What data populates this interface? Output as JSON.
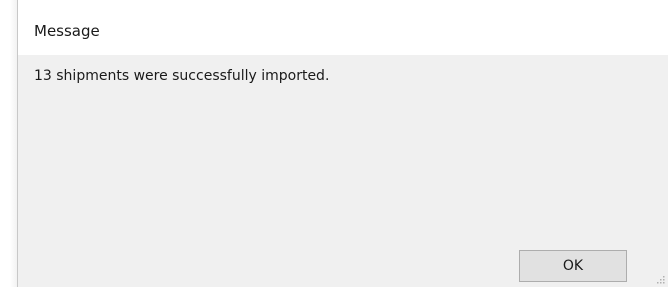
{
  "dialog": {
    "title": "Message",
    "message": "13 shipments were successfully imported.",
    "ok_label": "OK"
  },
  "colors": {
    "title_bar": "#ffffff",
    "body": "#f0f0f0",
    "button": "#e1e1e1",
    "button_border": "#adadad"
  },
  "icons": {
    "resize": "resize-grip-icon"
  }
}
